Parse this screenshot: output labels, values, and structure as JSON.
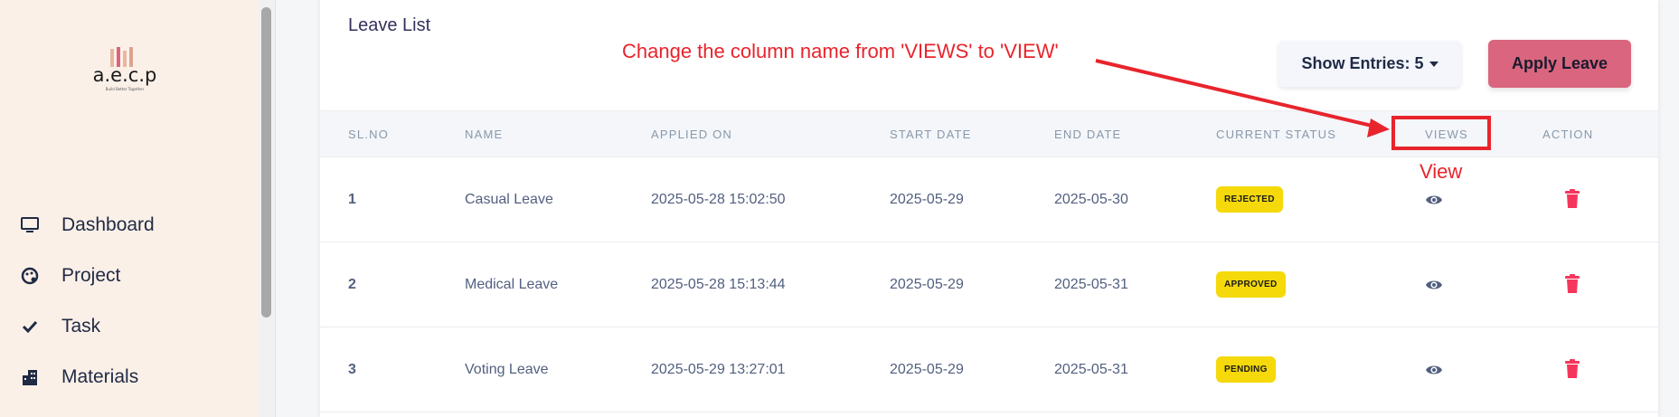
{
  "sidebar": {
    "logo_text": "a.e.c.p",
    "logo_tagline": "Build Better Together",
    "items": [
      {
        "label": "Dashboard",
        "icon": "monitor-icon"
      },
      {
        "label": "Project",
        "icon": "palette-icon"
      },
      {
        "label": "Task",
        "icon": "check-icon"
      },
      {
        "label": "Materials",
        "icon": "building-icon"
      }
    ]
  },
  "card": {
    "title": "Leave List",
    "entries_label": "Show Entries: 5",
    "apply_label": "Apply Leave"
  },
  "table": {
    "headers": [
      "SL.NO",
      "NAME",
      "APPLIED ON",
      "START DATE",
      "END DATE",
      "CURRENT STATUS",
      "VIEWS",
      "ACTION"
    ],
    "rows": [
      {
        "sl": "1",
        "name": "Casual Leave",
        "applied_on": "2025-05-28 15:02:50",
        "start": "2025-05-29",
        "end": "2025-05-30",
        "status": "REJECTED"
      },
      {
        "sl": "2",
        "name": "Medical Leave",
        "applied_on": "2025-05-28 15:13:44",
        "start": "2025-05-29",
        "end": "2025-05-31",
        "status": "APPROVED"
      },
      {
        "sl": "3",
        "name": "Voting Leave",
        "applied_on": "2025-05-29 13:27:01",
        "start": "2025-05-29",
        "end": "2025-05-31",
        "status": "PENDING"
      }
    ]
  },
  "annotation": {
    "note": "Change the column name from 'VIEWS' to 'VIEW'",
    "suggested": "View",
    "color": "#e8242c"
  },
  "colors": {
    "sidebar_bg": "#fbf0e8",
    "badge_bg": "#f5d90a",
    "apply_bg": "#d9667e",
    "trash": "#f5365c",
    "eye": "#525f7f"
  }
}
